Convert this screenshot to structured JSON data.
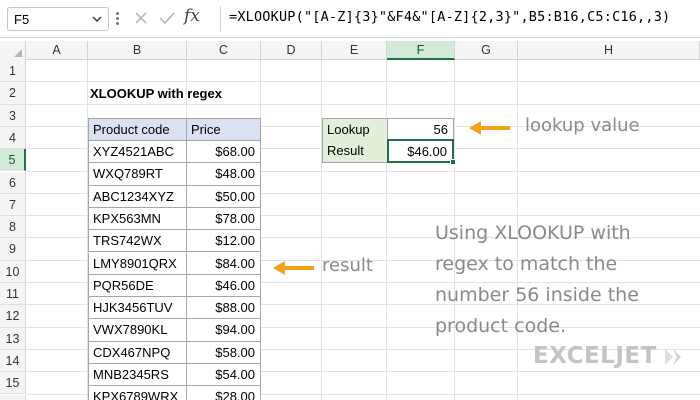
{
  "formula_bar": {
    "name_box": "F5",
    "fx_label": "fx",
    "formula": "=XLOOKUP(\"[A-Z]{3}\"&F4&\"[A-Z]{2,3}\",B5:B16,C5:C16,,3)"
  },
  "columns": [
    "A",
    "B",
    "C",
    "D",
    "E",
    "F",
    "G",
    "H"
  ],
  "active_column": "F",
  "rows": [
    "1",
    "2",
    "3",
    "4",
    "5",
    "6",
    "7",
    "8",
    "9",
    "10",
    "11",
    "12",
    "13",
    "14",
    "15",
    "16"
  ],
  "active_row": "5",
  "title": "XLOOKUP with regex",
  "table": {
    "headers": [
      "Product code",
      "Price"
    ],
    "rows": [
      [
        "XYZ4521ABC",
        "$68.00"
      ],
      [
        "WXQ789RT",
        "$48.00"
      ],
      [
        "ABC1234XYZ",
        "$50.00"
      ],
      [
        "KPX563MN",
        "$78.00"
      ],
      [
        "TRS742WX",
        "$12.00"
      ],
      [
        "LMY8901QRX",
        "$84.00"
      ],
      [
        "PQR56DE",
        "$46.00"
      ],
      [
        "HJK3456TUV",
        "$88.00"
      ],
      [
        "VWX7890KL",
        "$94.00"
      ],
      [
        "CDX467NPQ",
        "$58.00"
      ],
      [
        "MNB2345RS",
        "$54.00"
      ],
      [
        "KPX6789WRX",
        "$28.00"
      ]
    ]
  },
  "lookup": {
    "lookup_label": "Lookup",
    "lookup_value": "56",
    "result_label": "Result",
    "result_value": "$46.00"
  },
  "annotations": {
    "lookup_value": "lookup value",
    "result": "result",
    "note_lines": [
      "Using XLOOKUP with",
      "regex to match the",
      "number 56 inside the",
      "product code."
    ]
  },
  "logo": {
    "text": "EXCELJET"
  },
  "colors": {
    "accent_green": "#1e7145",
    "arrow_orange": "#f4a21d",
    "header_blue": "#d9e1f2",
    "label_green": "#e2efda"
  }
}
